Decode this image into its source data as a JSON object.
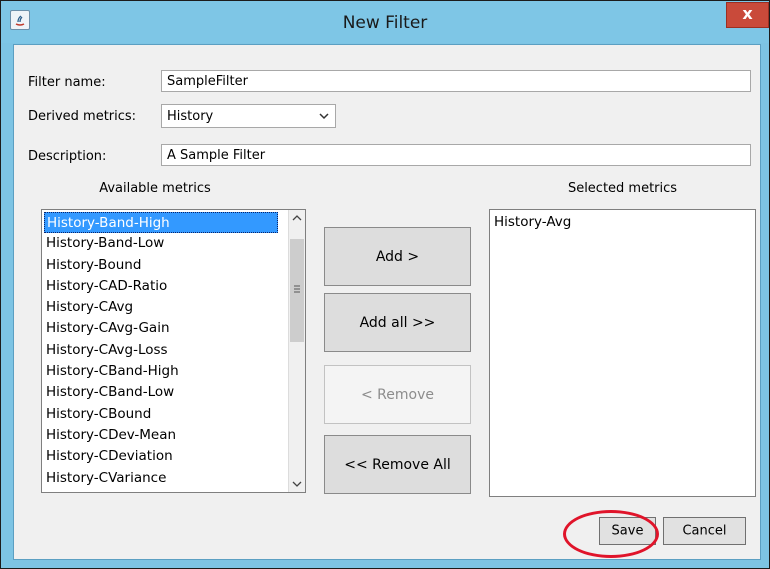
{
  "window": {
    "title": "New Filter",
    "close_label": "x"
  },
  "form": {
    "filter_name_label": "Filter name:",
    "filter_name_value": "SampleFilter",
    "derived_metrics_label": "Derived metrics:",
    "derived_metrics_value": "History",
    "description_label": "Description:",
    "description_value": "A Sample Filter"
  },
  "available": {
    "header": "Available metrics",
    "items": [
      "History-Band-High",
      "History-Band-Low",
      "History-Bound",
      "History-CAD-Ratio",
      "History-CAvg",
      "History-CAvg-Gain",
      "History-CAvg-Loss",
      "History-CBand-High",
      "History-CBand-Low",
      "History-CBound",
      "History-CDev-Mean",
      "History-CDeviation",
      "History-CVariance"
    ],
    "selected_item": "History-Band-High"
  },
  "selected": {
    "header": "Selected metrics",
    "items": [
      "History-Avg"
    ]
  },
  "buttons": {
    "add": "Add >",
    "add_all": "Add all >>",
    "remove": "< Remove",
    "remove_all": "<< Remove All",
    "save": "Save",
    "cancel": "Cancel"
  },
  "colors": {
    "titlebar": "#7ec6e6",
    "selection": "#3399ff",
    "annotation": "#e0142a",
    "close": "#c94a3a"
  },
  "icons": {
    "app": "java-app-icon",
    "close": "close-icon",
    "dropdown": "chevron-down-icon",
    "grip": "scroll-grip-icon"
  }
}
